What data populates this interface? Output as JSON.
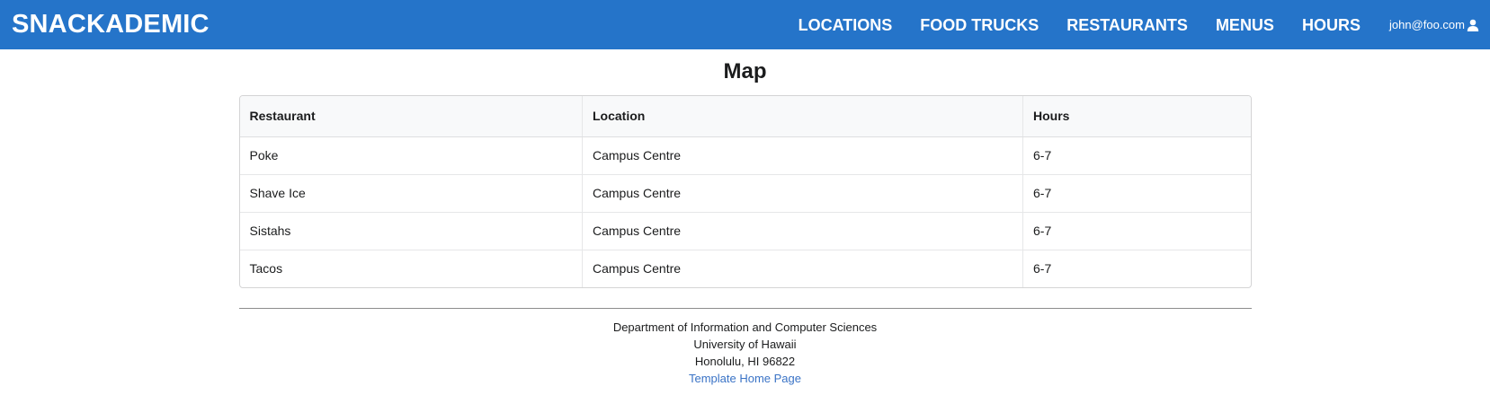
{
  "navbar": {
    "brand": "SNACKADEMIC",
    "links": [
      "LOCATIONS",
      "FOOD TRUCKS",
      "RESTAURANTS",
      "MENUS",
      "HOURS"
    ],
    "user": "john@foo.com",
    "user_icon": "user-icon",
    "bg_color": "#2574c9"
  },
  "main": {
    "title": "Map",
    "table": {
      "headers": [
        "Restaurant",
        "Location",
        "Hours"
      ],
      "rows": [
        [
          "Poke",
          "Campus Centre",
          "6-7"
        ],
        [
          "Shave Ice",
          "Campus Centre",
          "6-7"
        ],
        [
          "Sistahs",
          "Campus Centre",
          "6-7"
        ],
        [
          "Tacos",
          "Campus Centre",
          "6-7"
        ]
      ]
    }
  },
  "footer": {
    "line1": "Department of Information and Computer Sciences",
    "line2": "University of Hawaii",
    "line3": "Honolulu, HI 96822",
    "link": "Template Home Page"
  }
}
